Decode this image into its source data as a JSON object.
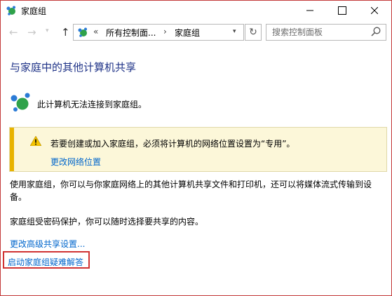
{
  "window": {
    "title": "家庭组",
    "controls": [
      "minimize",
      "maximize",
      "close"
    ]
  },
  "navigation": {
    "back_icon": "back-arrow-icon",
    "forward_icon": "forward-arrow-icon",
    "recent_icon": "chevron-down-icon",
    "up_icon": "up-arrow-icon",
    "breadcrumb_prefix": "«",
    "breadcrumb": [
      "所有控制面...",
      "家庭组"
    ],
    "breadcrumb_separator": "›",
    "search_placeholder": "搜索控制面板"
  },
  "content": {
    "heading": "与家庭中的其他计算机共享",
    "status_text": "此计算机无法连接到家庭组。",
    "warning": {
      "text": "若要创建或加入家庭组，必须将计算机的网络位置设置为“专用”。",
      "link": "更改网络位置"
    },
    "description": "使用家庭组，你可以与你家庭网络上的其他计算机共享文件和打印机，还可以将媒体流式传输到设备。",
    "password_note": "家庭组受密码保护，你可以随时选择要共享的内容。",
    "link_advanced_sharing": "更改高级共享设置...",
    "link_troubleshooter": "启动家庭组疑难解答"
  },
  "colors": {
    "heading": "#1e3287",
    "link": "#0066cc",
    "warning_bar": "#e8b300",
    "warning_bg": "#fcf7d9",
    "highlight": "#d03232"
  }
}
